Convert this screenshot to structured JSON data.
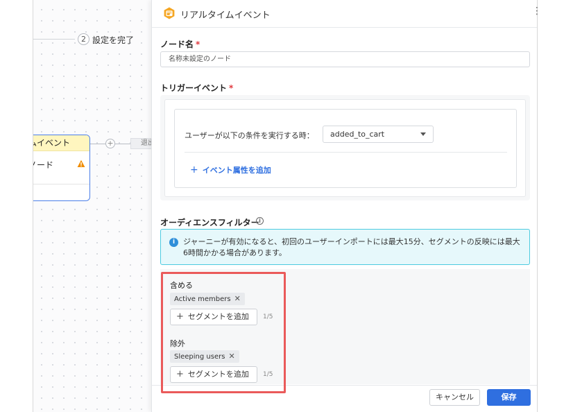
{
  "canvas": {
    "step_number": "2",
    "step_label": "設定を完了",
    "node": {
      "title": "ムイベント",
      "body": "ノード"
    },
    "exit_label": "退出"
  },
  "panel": {
    "title": "リアルタイムイベント",
    "more_icon": "vertical-ellipsis",
    "node_name": {
      "label": "ノード名",
      "required_mark": "*",
      "value": "名称未設定のノード"
    },
    "trigger": {
      "label": "トリガーイベント",
      "required_mark": "*",
      "condition_label": "ユーザーが以下の条件を実行する時：",
      "event_value": "added_to_cart",
      "add_attribute": "イベント属性を追加"
    },
    "audience": {
      "label": "オーディエンスフィルター",
      "notice": "ジャーニーが有効になると、初回のユーザーインポートには最大15分、セグメントの反映には最大6時間かかる場合があります。",
      "include": {
        "label": "含める",
        "chips": [
          "Active members"
        ],
        "add_label": "セグメントを追加",
        "count": "1/5"
      },
      "exclude": {
        "label": "除外",
        "chips": [
          "Sleeping users"
        ],
        "add_label": "セグメントを追加",
        "count": "1/5"
      }
    },
    "footer": {
      "cancel": "キャンセル",
      "save": "保存"
    }
  },
  "colors": {
    "accent": "#2f6fe0",
    "node_border": "#4a7ee8",
    "node_header": "#fff6bf",
    "warning": "#f08c00",
    "required": "#e0383e",
    "notice_border": "#4ccbe0",
    "notice_bg": "#e6f8fb",
    "highlight": "#ea5a5a",
    "panel_icon": "#f5a623"
  }
}
